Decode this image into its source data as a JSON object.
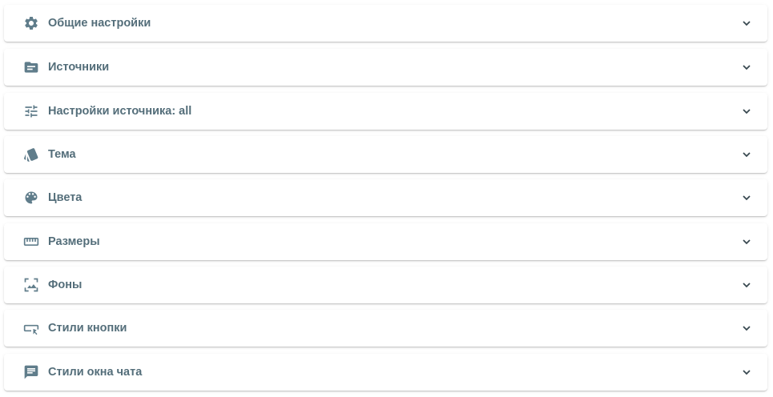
{
  "panels": [
    {
      "label": "Общие настройки",
      "icon": "gear-icon"
    },
    {
      "label": "Источники",
      "icon": "folder-icon"
    },
    {
      "label": "Настройки источника: all",
      "icon": "sliders-icon"
    },
    {
      "label": "Тема",
      "icon": "theme-swatch-icon"
    },
    {
      "label": "Цвета",
      "icon": "palette-icon"
    },
    {
      "label": "Размеры",
      "icon": "ruler-icon"
    },
    {
      "label": "Фоны",
      "icon": "image-frame-icon"
    },
    {
      "label": "Стили кнопки",
      "icon": "button-cursor-icon"
    },
    {
      "label": "Стили окна чата",
      "icon": "chat-bubble-icon"
    }
  ],
  "colors": {
    "text": "#546e7a",
    "icon": "#607d8b",
    "chevron": "#37474f",
    "panel_bg": "#ffffff"
  }
}
